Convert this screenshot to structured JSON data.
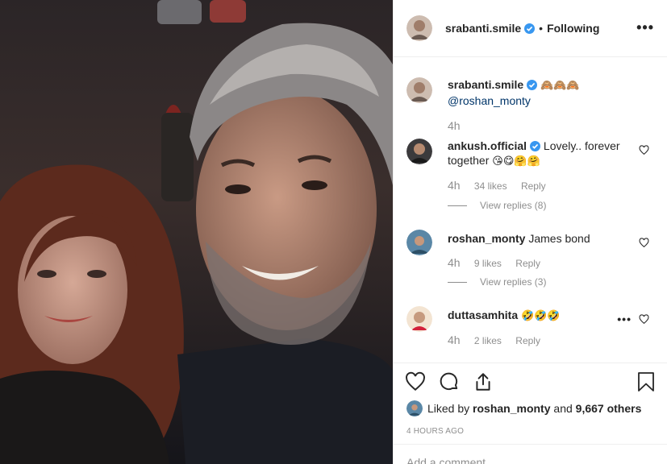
{
  "post_author": {
    "username": "srabanti.smile",
    "verified": true,
    "follow_status": "Following",
    "separator": "•",
    "more_label": "•••"
  },
  "caption": {
    "username": "srabanti.smile",
    "emojis": "🙈🙈🙈",
    "mention": "@roshan_monty",
    "time": "4h"
  },
  "comments": [
    {
      "username": "ankush.official",
      "verified": true,
      "text": "Lovely.. forever together",
      "emojis": "😘😋🤗🤗",
      "time": "4h",
      "likes": "34 likes",
      "reply_label": "Reply",
      "view_replies": "View replies (8)"
    },
    {
      "username": "roshan_monty",
      "verified": false,
      "text": "James bond",
      "emojis": "",
      "time": "4h",
      "likes": "9 likes",
      "reply_label": "Reply",
      "view_replies": "View replies (3)"
    },
    {
      "username": "duttasamhita",
      "verified": false,
      "text": "",
      "emojis": "🤣🤣🤣",
      "time": "4h",
      "likes": "2 likes",
      "reply_label": "Reply",
      "more_label": "•••"
    }
  ],
  "engagement": {
    "liked_by_prefix": "Liked by",
    "liked_by_user": "roshan_monty",
    "and_label": "and",
    "others": "9,667 others",
    "timestamp": "4 HOURS AGO",
    "add_comment_placeholder": "Add a comment…"
  },
  "icons": {
    "like": "heart-outline-icon",
    "comment": "speech-bubble-icon",
    "share": "share-icon",
    "save": "bookmark-icon",
    "verified": "verified-badge-icon",
    "comment_like": "small-heart-icon"
  },
  "colors": {
    "verified_blue": "#3897f0",
    "link": "#003569",
    "muted": "#8e8e8e",
    "text": "#262626",
    "divider": "#efefef"
  }
}
